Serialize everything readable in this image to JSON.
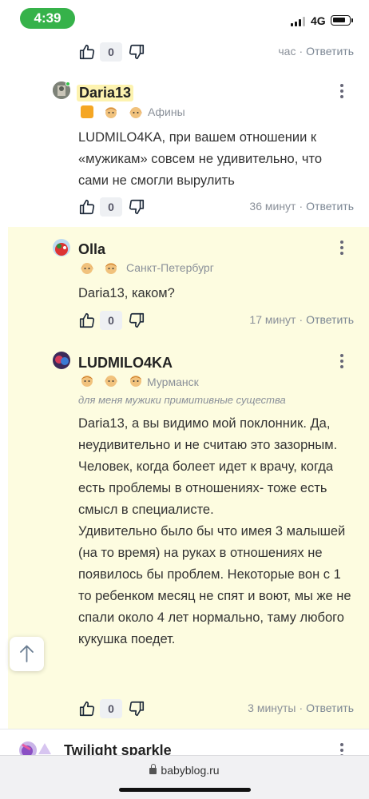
{
  "status_bar": {
    "time": "4:39",
    "network": "4G"
  },
  "top_actions": {
    "count": "0",
    "time": "час",
    "reply": "Ответить"
  },
  "comments": [
    {
      "username": "Daria13",
      "city": "Афины",
      "text": [
        "LUDMILO4KA, при вашем отношении к «мужикам» совсем не удивительно, что сами не смогли вырулить"
      ],
      "count": "0",
      "time": "36 минут",
      "reply": "Ответить"
    },
    {
      "username": "Olla",
      "city": "Санкт-Петербург",
      "text": [
        "Daria13, каком?"
      ],
      "count": "0",
      "time": "17 минут",
      "reply": "Ответить"
    },
    {
      "username": "LUDMILO4KA",
      "city": "Мурманск",
      "status": "для меня мужики примитивные существа",
      "text": [
        "Daria13, а вы видимо мой поклонник. Да, неудивительно и не считаю это зазорным. Человек, когда болеет идет к врачу, когда есть проблемы в отношениях- тоже есть смысл в специалисте.",
        "Удивительно было бы что имея 3 малышей (на то время) на руках в отношениях не появилось бы проблем. Некоторые вон с 1 то ребенком месяц не спят и воют, мы же не спали около 4 лет нормально, таму любого кукушка поедет."
      ],
      "count": "0",
      "time": "3 минуты",
      "reply": "Ответить"
    },
    {
      "username": "Twilight sparkle"
    }
  ],
  "browser": {
    "url": "babyblog.ru"
  },
  "colors": {
    "accent_green": "#36b24a",
    "highlight_bg": "#fdfce0",
    "name_highlight": "#fdf3b0"
  },
  "icons": [
    "like-icon",
    "dislike-icon",
    "kebab-menu-icon",
    "arrow-up-icon",
    "lock-icon",
    "child-badge-icon"
  ]
}
